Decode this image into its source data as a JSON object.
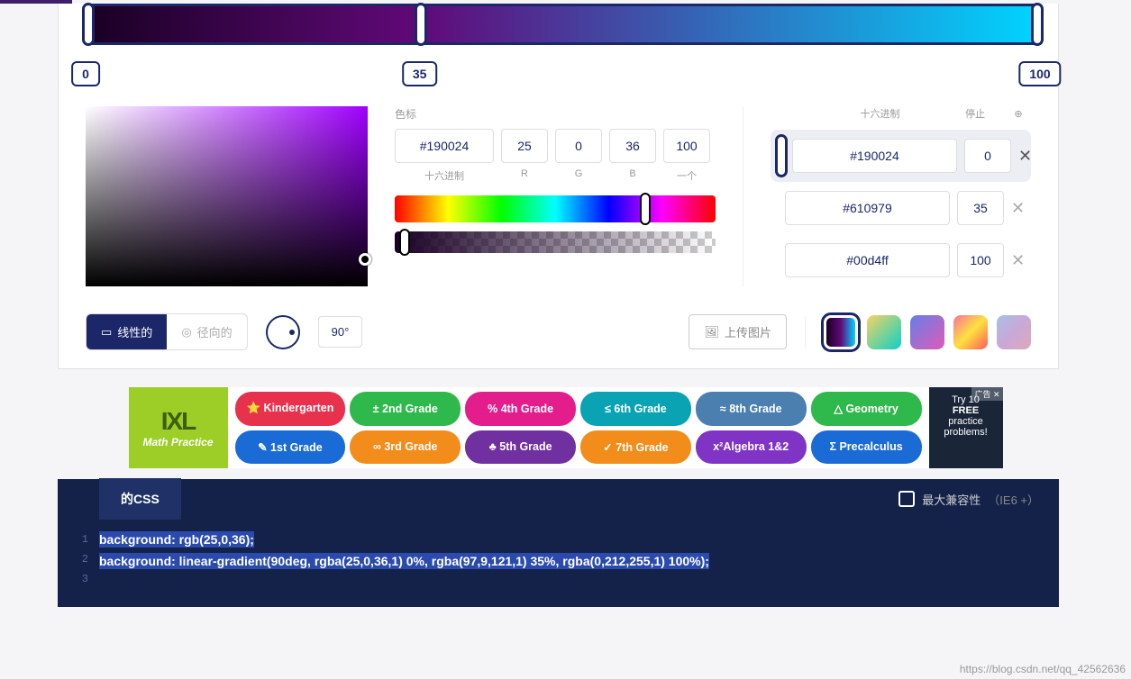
{
  "gradient": {
    "stops": [
      {
        "pos": 0,
        "hex": "#190024",
        "swatch": "#190024"
      },
      {
        "pos": 35,
        "hex": "#610979",
        "swatch": "#610979"
      },
      {
        "pos": 100,
        "hex": "#00d4ff",
        "swatch": "#00d4ff"
      }
    ],
    "activeStop": 0
  },
  "stopLabels": [
    "0",
    "35",
    "100"
  ],
  "sections": {
    "sebiao": "色标",
    "hex_label": "十六进制",
    "rgba_labels": [
      "R",
      "G",
      "B",
      "一个"
    ],
    "stops_hex": "十六进制",
    "stops_stop": "停止",
    "stops_add": "⊕"
  },
  "currentColor": {
    "hex": "#190024",
    "r": "25",
    "g": "0",
    "b": "36",
    "a": "100"
  },
  "stopsList": [
    {
      "hex": "#190024",
      "pos": "0",
      "swatch": "#190024",
      "active": true
    },
    {
      "hex": "#610979",
      "pos": "35",
      "swatch": "#610979",
      "active": false
    },
    {
      "hex": "#00d4ff",
      "pos": "100",
      "swatch": "#00d4ff",
      "active": false
    }
  ],
  "typeToggle": {
    "linear": "线性的",
    "radial": "径向的"
  },
  "angle": "90°",
  "uploadLabel": "上传图片",
  "presets": [
    {
      "css": "linear-gradient(90deg,#190024,#610979,#00d4ff)",
      "active": true
    },
    {
      "css": "linear-gradient(135deg,#f6d365,#0bd1c5)",
      "active": false
    },
    {
      "css": "linear-gradient(135deg,#667eea,#e05bb5)",
      "active": false
    },
    {
      "css": "linear-gradient(135deg,#fa709a,#fee140,#ff5858)",
      "active": false
    },
    {
      "css": "linear-gradient(135deg,#a8c0e8,#c8a8d8,#e0a8b8)",
      "active": false
    }
  ],
  "ad": {
    "logo": "IXL",
    "subtitle": "Math Practice",
    "pills": [
      {
        "text": "⭐ Kindergarten",
        "bg": "#e8314d"
      },
      {
        "text": "± 2nd Grade",
        "bg": "#2fb84c"
      },
      {
        "text": "% 4th Grade",
        "bg": "#e31e8c"
      },
      {
        "text": "≤ 6th Grade",
        "bg": "#0aa3b3"
      },
      {
        "text": "≈ 8th Grade",
        "bg": "#4a7fb0"
      },
      {
        "text": "△ Geometry",
        "bg": "#2fb84c"
      },
      {
        "text": "✎ 1st Grade",
        "bg": "#1b6bd6"
      },
      {
        "text": "∞ 3rd Grade",
        "bg": "#f28c1a"
      },
      {
        "text": "♣ 5th Grade",
        "bg": "#7030a0"
      },
      {
        "text": "✓ 7th Grade",
        "bg": "#f28c1a"
      },
      {
        "text": "x²Algebra 1&2",
        "bg": "#8034c6"
      },
      {
        "text": "Σ Precalculus",
        "bg": "#1b6bd6"
      }
    ],
    "right_lines": [
      "Try 10",
      "FREE",
      "practice",
      "problems!"
    ],
    "corner": "广告 ✕"
  },
  "code": {
    "tab": "的CSS",
    "compat_label": "最大兼容性",
    "compat_suffix": "（IE6 +）",
    "lines": [
      "background: rgb(25,0,36);",
      "background: linear-gradient(90deg, rgba(25,0,36,1) 0%, rgba(97,9,121,1) 35%, rgba(0,212,255,1) 100%);",
      ""
    ]
  },
  "watermark": "https://blog.csdn.net/qq_42562636"
}
